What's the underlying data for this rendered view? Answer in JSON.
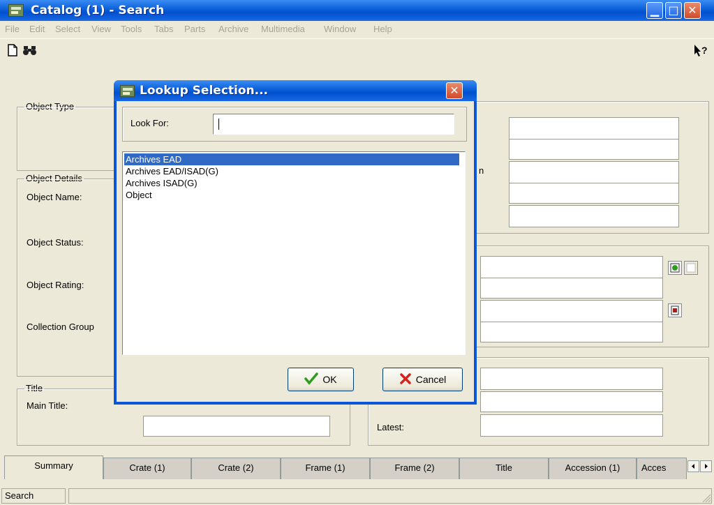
{
  "window": {
    "title": "Catalog (1) - Search",
    "minimize_glyph": "▁",
    "maximize_glyph": "□",
    "close_glyph": "✕"
  },
  "menu": [
    "File",
    "Edit",
    "Select",
    "View",
    "Tools",
    "Tabs",
    "Parts",
    "Archive",
    "Multimedia",
    "Window",
    "Help"
  ],
  "toolbar": {
    "new_glyph": "🗋",
    "find_glyph": "🔭",
    "help_glyph": "↖?"
  },
  "form": {
    "object_type_legend": "Object Type",
    "object_details_legend": "Object Details",
    "object_name_label": "Object Name:",
    "object_status_label": "Object Status:",
    "object_rating_label": "Object Rating:",
    "collection_group_label": "Collection Group",
    "title_legend": "Title",
    "main_title_label": "Main Title:",
    "partial_label_n": "n",
    "latest_label": "Latest:"
  },
  "tabs": [
    "Summary",
    "Crate (1)",
    "Crate (2)",
    "Frame (1)",
    "Frame (2)",
    "Title",
    "Accession (1)",
    "Acces"
  ],
  "statusbar": {
    "text": "Search"
  },
  "dialog": {
    "title": "Lookup Selection...",
    "look_for_label": "Look For:",
    "look_for_value": "",
    "items": [
      "Archives EAD",
      "Archives EAD/ISAD(G)",
      "Archives ISAD(G)",
      "Object"
    ],
    "selected_index": 0,
    "ok_label": "OK",
    "cancel_label": "Cancel"
  },
  "colors": {
    "selection": "#316ac5",
    "titlebar": "#0a5fd8",
    "ok_check": "#2e9a1e",
    "cancel_x": "#d4231c"
  }
}
